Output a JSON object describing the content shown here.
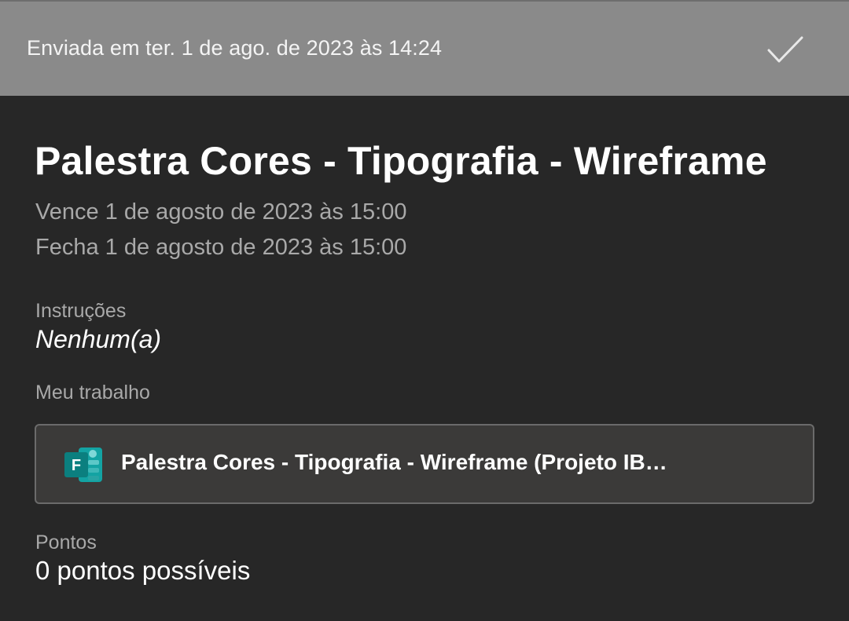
{
  "header": {
    "submitted_text": "Enviada em ter. 1 de ago. de 2023 às 14:24",
    "check_icon": "checkmark-icon"
  },
  "assignment": {
    "title": "Palestra Cores - Tipografia - Wireframe",
    "due": "Vence 1 de agosto de 2023 às 15:00",
    "closes": "Fecha 1 de agosto de 2023 às 15:00"
  },
  "instructions": {
    "label": "Instruções",
    "value": "Nenhum(a)"
  },
  "my_work": {
    "label": "Meu trabalho",
    "item_icon": "microsoft-forms-icon",
    "item_icon_letter": "F",
    "item_title": "Palestra Cores - Tipografia - Wireframe (Projeto IB…"
  },
  "points": {
    "label": "Pontos",
    "value": "0 pontos possíveis"
  },
  "colors": {
    "header_bg": "#8a8a8a",
    "page_bg": "#272727",
    "card_bg": "#3b3a39",
    "forms_teal": "#0b8a8a"
  }
}
